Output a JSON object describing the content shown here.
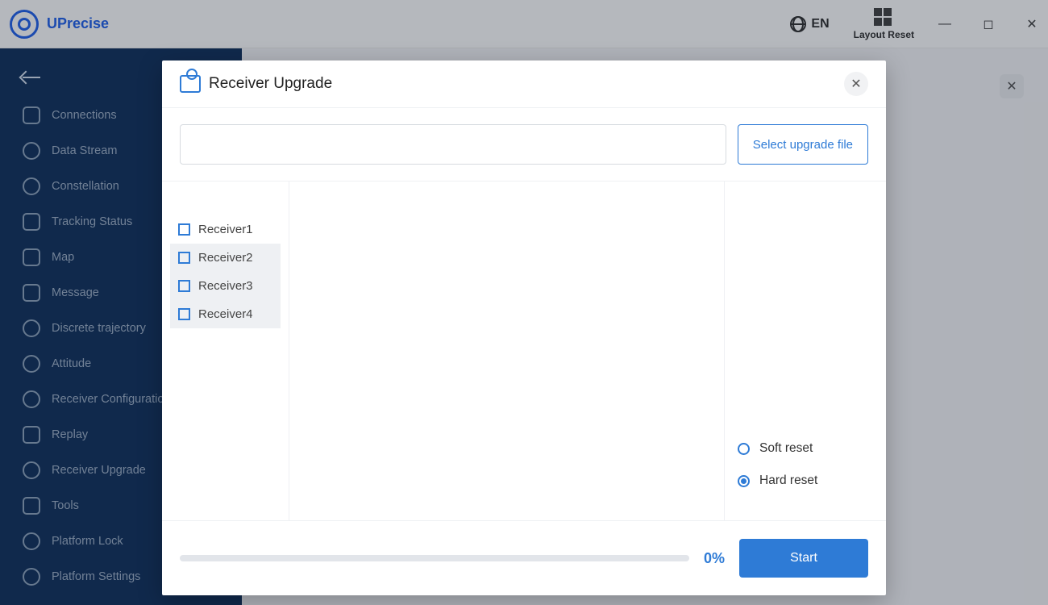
{
  "app": {
    "name": "UPrecise"
  },
  "titlebar": {
    "lang": "EN",
    "layout_reset": "Layout Reset"
  },
  "sidebar": {
    "items": [
      "Connections",
      "Data Stream",
      "Constellation",
      "Tracking Status",
      "Map",
      "Message",
      "Discrete trajectory",
      "Attitude",
      "Receiver Configurations",
      "Replay",
      "Receiver Upgrade",
      "Tools",
      "Platform Lock",
      "Platform Settings"
    ]
  },
  "modal": {
    "title": "Receiver Upgrade",
    "select_button": "Select upgrade file",
    "file_path": "",
    "receivers": [
      "Receiver1",
      "Receiver2",
      "Receiver3",
      "Receiver4"
    ],
    "reset_options": {
      "soft": "Soft reset",
      "hard": "Hard reset"
    },
    "reset_selected": "hard",
    "progress_pct": "0%",
    "start_button": "Start"
  }
}
